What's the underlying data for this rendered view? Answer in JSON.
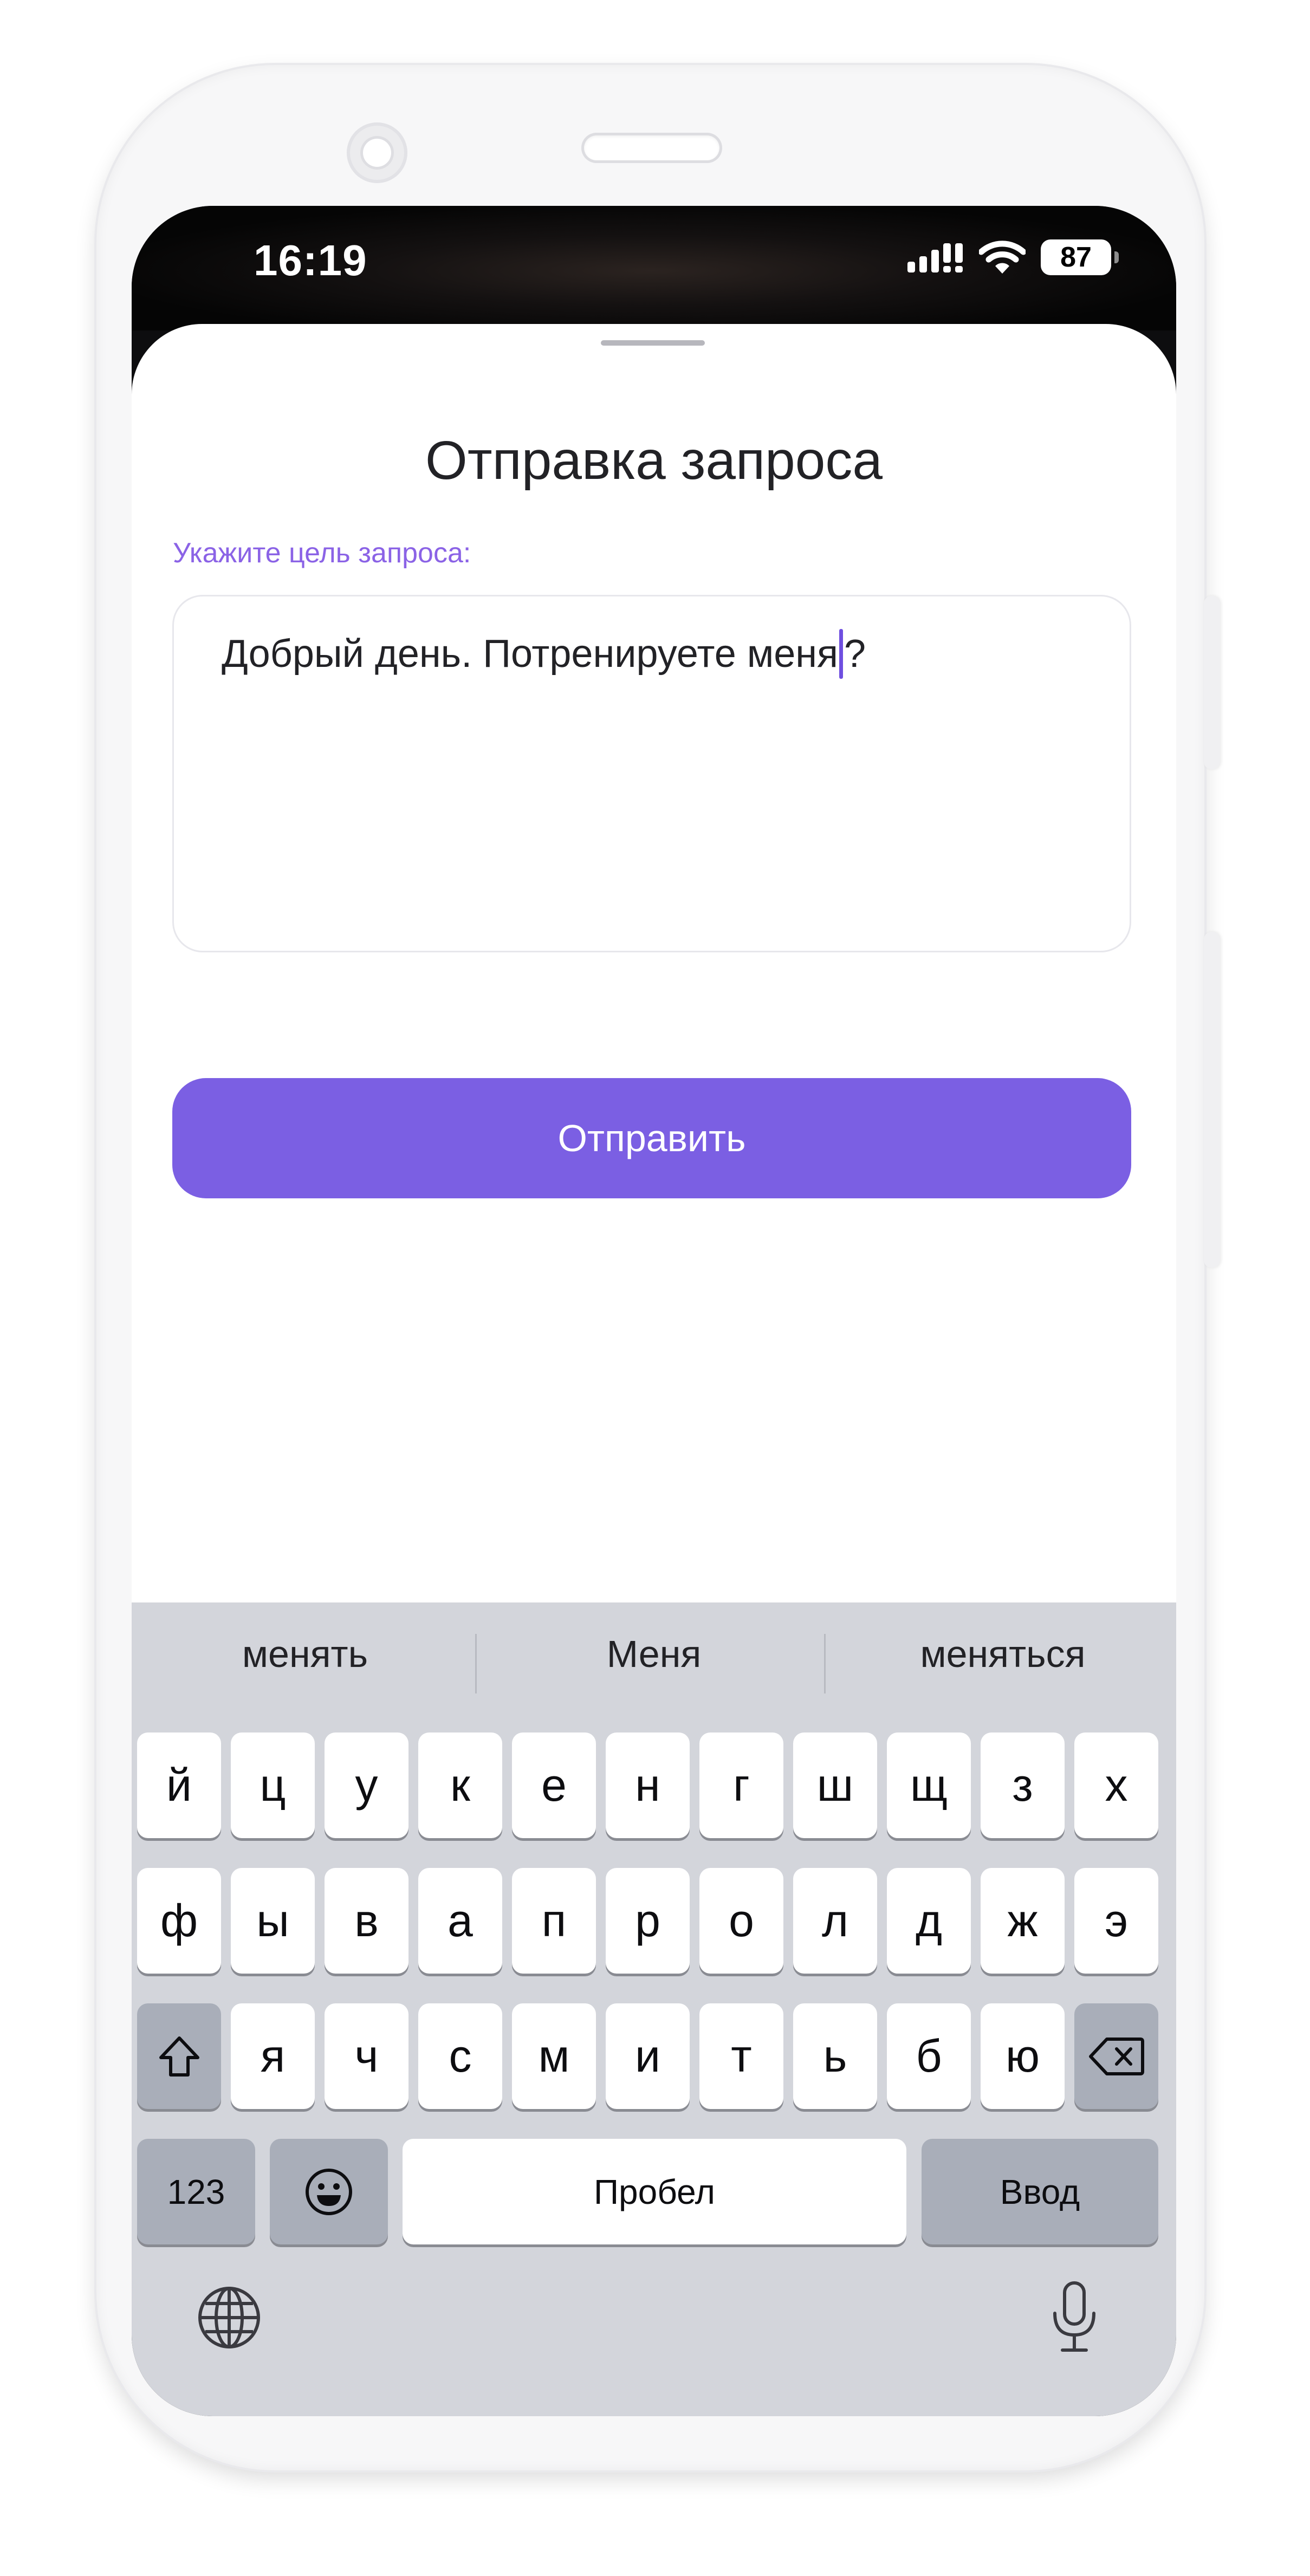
{
  "status_bar": {
    "time": "16:19",
    "battery": "87",
    "signal_icon": "cellular-signal-icon",
    "wifi_icon": "wifi-icon"
  },
  "sheet": {
    "title": "Отправка запроса",
    "field_label": "Укажите цель запроса:",
    "text_before_caret": "Добрый день. Потренируете меня",
    "text_after_caret": "?",
    "send_label": "Отправить"
  },
  "keyboard": {
    "suggestions": [
      "менять",
      "Меня",
      "меняться"
    ],
    "row1": [
      "й",
      "ц",
      "у",
      "к",
      "е",
      "н",
      "г",
      "ш",
      "щ",
      "з",
      "х"
    ],
    "row2": [
      "ф",
      "ы",
      "в",
      "а",
      "п",
      "р",
      "о",
      "л",
      "д",
      "ж",
      "э"
    ],
    "row3": [
      "я",
      "ч",
      "с",
      "м",
      "и",
      "т",
      "ь",
      "б",
      "ю"
    ],
    "numbers_label": "123",
    "space_label": "Пробел",
    "return_label": "Ввод",
    "shift_icon": "shift-icon",
    "delete_icon": "backspace-icon",
    "emoji_icon": "emoji-icon",
    "globe_icon": "globe-icon",
    "mic_icon": "microphone-icon"
  },
  "colors": {
    "accent": "#7b5fe3",
    "label": "#8b63e6",
    "keyboard_bg": "#d3d5db",
    "key_dark": "#a9aeb9"
  }
}
